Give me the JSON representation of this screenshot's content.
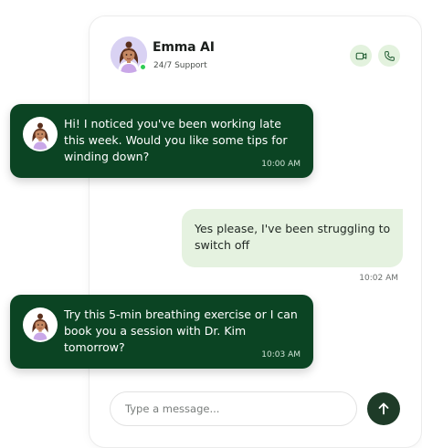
{
  "header": {
    "name": "Emma AI",
    "subtitle": "24/7 Support",
    "status": "online",
    "icons": {
      "video": "video-camera-icon",
      "call": "phone-icon"
    }
  },
  "messages": [
    {
      "sender": "bot",
      "text": "Hi! I noticed you've been working late this week. Would you like some tips for winding down?",
      "time": "10:00 AM"
    },
    {
      "sender": "user",
      "text": "Yes please, I've been struggling to switch off",
      "time": "10:02 AM"
    },
    {
      "sender": "bot",
      "text": "Try this 5-min breathing exercise  or I can book you a session with Dr. Kim tomorrow?",
      "time": "10:03 AM"
    }
  ],
  "composer": {
    "placeholder": "Type a message...",
    "value": "",
    "send_icon": "arrow-up-icon"
  },
  "colors": {
    "bot_bubble": "#0b4423",
    "user_bubble": "#e5f2e0",
    "send_button": "#1e3b28",
    "call_button_bg": "#e3f2de",
    "online": "#2ecc55"
  }
}
